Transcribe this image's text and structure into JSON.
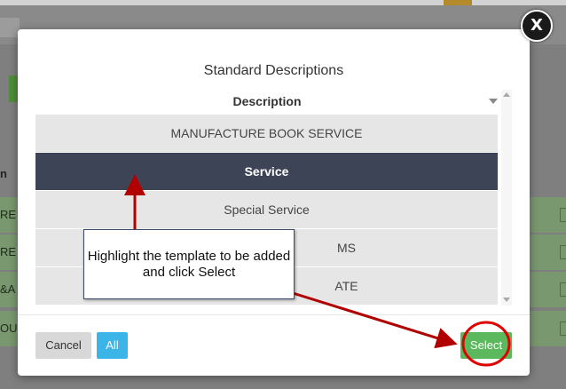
{
  "modal": {
    "title": "Standard Descriptions",
    "column_header": "Description",
    "rows": [
      "MANUFACTURE BOOK SERVICE",
      "Service",
      "Special Service",
      "MS",
      "ATE"
    ],
    "selected_row": "Service",
    "cancel_label": "Cancel",
    "all_label": "All",
    "select_label": "Select",
    "close_label": "X"
  },
  "background": {
    "label": "n",
    "rows": [
      "RE",
      "RE",
      "&A",
      "OUR"
    ]
  },
  "annotation": {
    "callout_text": "Highlight the template to be added and click Select",
    "arrow_color": "#b00000",
    "highlight_color": "#e00000"
  },
  "colors": {
    "selected_row_bg": "#3d4456",
    "select_button": "#5cb85c",
    "all_button": "#3bb4e8"
  }
}
